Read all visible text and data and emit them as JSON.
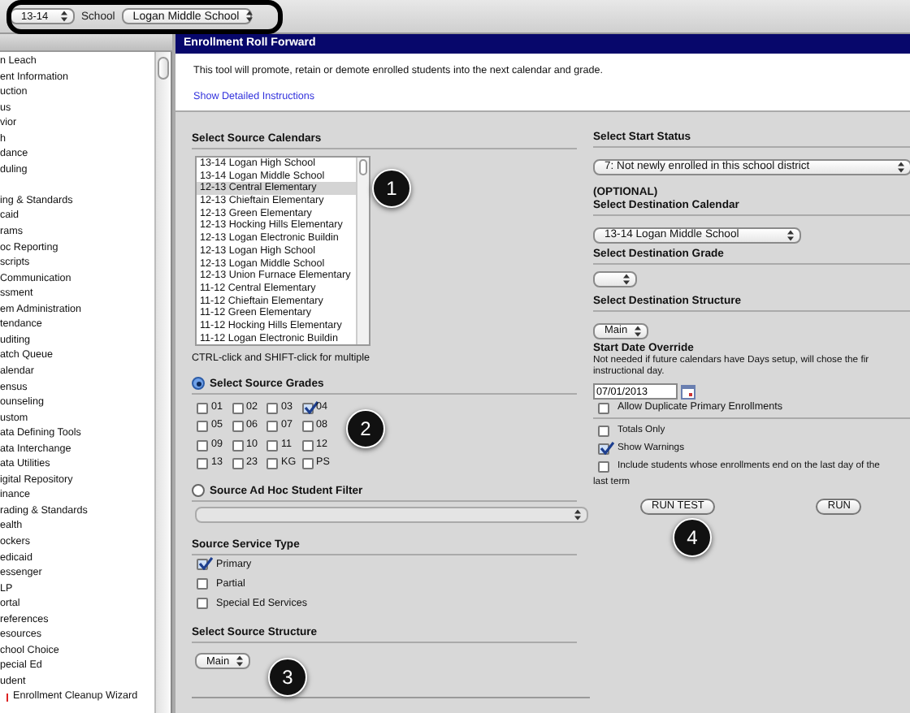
{
  "toolbar": {
    "year": "13-14",
    "school_label": "School",
    "school": "Logan Middle School"
  },
  "sidebar": {
    "items": [
      {
        "label": "n Leach",
        "kind": "plain"
      },
      {
        "label": "ent Information",
        "kind": "plain"
      },
      {
        "label": "uction",
        "kind": "plain"
      },
      {
        "label": "us",
        "kind": "plain"
      },
      {
        "label": "vior",
        "kind": "plain"
      },
      {
        "label": "h",
        "kind": "plain"
      },
      {
        "label": "dance",
        "kind": "plain"
      },
      {
        "label": "duling",
        "kind": "plain"
      },
      {
        "kind": "gap"
      },
      {
        "label": "ing & Standards",
        "kind": "plain"
      },
      {
        "label": "caid",
        "kind": "plain"
      },
      {
        "label": "rams",
        "kind": "plain"
      },
      {
        "label": "oc Reporting",
        "kind": "plain"
      },
      {
        "label": "scripts",
        "kind": "plain"
      },
      {
        "label": " Communication",
        "kind": "plain"
      },
      {
        "label": "ssment",
        "kind": "plain"
      },
      {
        "label": "em Administration",
        "kind": "plain"
      },
      {
        "label": "tendance",
        "kind": "plain"
      },
      {
        "label": "uditing",
        "kind": "plain"
      },
      {
        "label": "atch Queue",
        "kind": "plain"
      },
      {
        "label": "alendar",
        "kind": "plain"
      },
      {
        "label": "ensus",
        "kind": "plain"
      },
      {
        "label": "ounseling",
        "kind": "plain"
      },
      {
        "label": "ustom",
        "kind": "plain"
      },
      {
        "label": "ata Defining Tools",
        "kind": "plain"
      },
      {
        "label": "ata Interchange",
        "kind": "plain"
      },
      {
        "label": "ata Utilities",
        "kind": "plain"
      },
      {
        "label": "igital Repository",
        "kind": "plain"
      },
      {
        "label": "inance",
        "kind": "plain"
      },
      {
        "label": "rading & Standards",
        "kind": "plain"
      },
      {
        "label": "ealth",
        "kind": "plain"
      },
      {
        "label": "ockers",
        "kind": "plain"
      },
      {
        "label": "edicaid",
        "kind": "plain"
      },
      {
        "label": "essenger",
        "kind": "plain"
      },
      {
        "label": "LP",
        "kind": "plain"
      },
      {
        "label": "ortal",
        "kind": "plain"
      },
      {
        "label": "references",
        "kind": "plain"
      },
      {
        "label": "esources",
        "kind": "plain"
      },
      {
        "label": "chool Choice",
        "kind": "plain"
      },
      {
        "label": "pecial Ed",
        "kind": "plain"
      },
      {
        "label": "udent",
        "kind": "plain"
      },
      {
        "label": "Enrollment Cleanup Wizard",
        "kind": "marked"
      }
    ]
  },
  "panel": {
    "title": "Enrollment Roll Forward",
    "intro": "This tool will promote, retain or demote enrolled students into the next calendar and grade.",
    "instructions_link": "Show Detailed Instructions",
    "source_calendars": {
      "label": "Select Source Calendars",
      "hint": "CTRL-click and SHIFT-click for multiple",
      "options": [
        {
          "label": "13-14 Logan High School",
          "selected": false
        },
        {
          "label": "13-14 Logan Middle School",
          "selected": false
        },
        {
          "label": "12-13 Central Elementary",
          "selected": true
        },
        {
          "label": "12-13 Chieftain Elementary",
          "selected": false
        },
        {
          "label": "12-13 Green Elementary",
          "selected": false
        },
        {
          "label": "12-13 Hocking Hills Elementary",
          "selected": false
        },
        {
          "label": "12-13 Logan Electronic Buildin",
          "selected": false
        },
        {
          "label": "12-13 Logan High School",
          "selected": false
        },
        {
          "label": "12-13 Logan Middle School",
          "selected": false
        },
        {
          "label": "12-13 Union Furnace Elementary",
          "selected": false
        },
        {
          "label": "11-12 Central Elementary",
          "selected": false
        },
        {
          "label": "11-12 Chieftain Elementary",
          "selected": false
        },
        {
          "label": "11-12 Green Elementary",
          "selected": false
        },
        {
          "label": "11-12 Hocking Hills Elementary",
          "selected": false
        },
        {
          "label": "11-12 Logan Electronic Buildin",
          "selected": false
        }
      ]
    },
    "source_grades": {
      "label": "Select Source Grades",
      "selected": true,
      "grades": [
        {
          "label": "01",
          "checked": false
        },
        {
          "label": "02",
          "checked": false
        },
        {
          "label": "03",
          "checked": false
        },
        {
          "label": "04",
          "checked": true
        },
        {
          "label": "05",
          "checked": false
        },
        {
          "label": "06",
          "checked": false
        },
        {
          "label": "07",
          "checked": false
        },
        {
          "label": "08",
          "checked": false
        },
        {
          "label": "09",
          "checked": false
        },
        {
          "label": "10",
          "checked": false
        },
        {
          "label": "11",
          "checked": false
        },
        {
          "label": "12",
          "checked": false
        },
        {
          "label": "13",
          "checked": false
        },
        {
          "label": "23",
          "checked": false
        },
        {
          "label": "KG",
          "checked": false
        },
        {
          "label": "PS",
          "checked": false
        }
      ]
    },
    "ad_hoc_filter": {
      "label": "Source Ad Hoc Student Filter",
      "selected": false,
      "disabled": true
    },
    "service_type": {
      "label": "Source Service Type",
      "options": [
        {
          "label": "Primary",
          "checked": true
        },
        {
          "label": "Partial",
          "checked": false
        },
        {
          "label": "Special Ed Services",
          "checked": false
        }
      ]
    },
    "source_structure": {
      "label": "Select Source Structure",
      "value": "Main"
    },
    "start_status": {
      "label": "Select Start Status",
      "value": "7: Not newly enrolled in this school district"
    },
    "destination_calendar": {
      "note": "(OPTIONAL)",
      "label": "Select Destination Calendar",
      "value": "13-14 Logan Middle School"
    },
    "destination_grade": {
      "label": "Select Destination Grade"
    },
    "destination_structure": {
      "label": "Select Destination Structure",
      "value": "Main"
    },
    "start_date": {
      "label": "Start Date Override",
      "note_lines": [
        "Not needed if future calendars have Days setup, will chose the fir",
        "instructional day."
      ],
      "value": "07/01/2013"
    },
    "allow_duplicate": {
      "label": "Allow Duplicate Primary Enrollments",
      "checked": false
    },
    "run_options": [
      {
        "label_lines": [
          "Totals Only"
        ],
        "checked": false
      },
      {
        "label_lines": [
          "Show Warnings"
        ],
        "checked": true
      },
      {
        "label_lines": [
          "Include students whose enrollments end on the last day of the",
          "last term"
        ],
        "checked": false
      }
    ],
    "buttons": [
      "RUN TEST",
      "RUN"
    ]
  },
  "callouts": [
    "1",
    "2",
    "3",
    "4"
  ]
}
